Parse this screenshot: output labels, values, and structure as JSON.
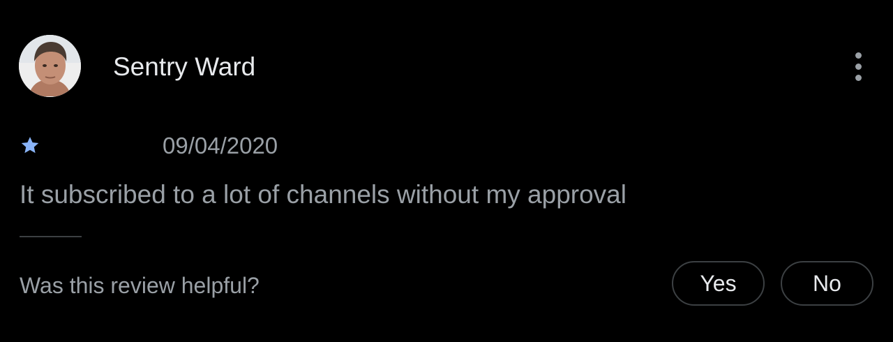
{
  "review": {
    "author": "Sentry Ward",
    "rating": 1,
    "rating_max": 5,
    "date": "09/04/2020",
    "text": "It subscribed to a lot of channels without my approval"
  },
  "helpful": {
    "question": "Was this review helpful?",
    "yes_label": "Yes",
    "no_label": "No"
  },
  "icons": {
    "avatar": "avatar-photo",
    "menu": "more-vert-icon",
    "rating": "star-icon"
  },
  "colors": {
    "background": "#000000",
    "star": "#8ab4f8",
    "primary_text": "#e8eaed",
    "secondary_text": "#9aa0a6",
    "border": "#3c4043"
  }
}
